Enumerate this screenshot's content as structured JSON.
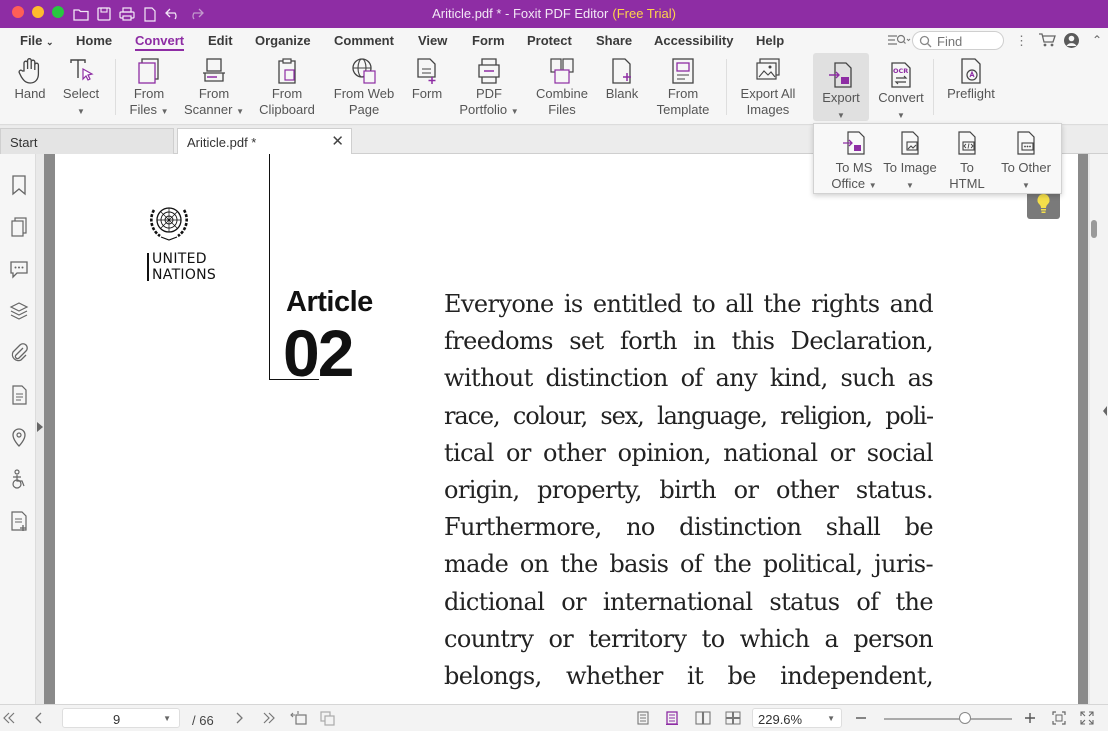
{
  "window": {
    "title": "Ariticle.pdf * - Foxit PDF Editor",
    "trial_label": "(Free Trial)"
  },
  "menu": {
    "items": [
      "File",
      "Home",
      "Convert",
      "Edit",
      "Organize",
      "Comment",
      "View",
      "Form",
      "Protect",
      "Share",
      "Accessibility",
      "Help"
    ],
    "active": "Convert",
    "find_placeholder": "Find"
  },
  "ribbon": {
    "hand": "Hand",
    "select": "Select",
    "from_files": [
      "From",
      "Files"
    ],
    "from_scanner": [
      "From",
      "Scanner"
    ],
    "from_clipboard": [
      "From",
      "Clipboard"
    ],
    "from_web_page": [
      "From Web",
      "Page"
    ],
    "form": "Form",
    "pdf_portfolio": [
      "PDF",
      "Portfolio"
    ],
    "combine_files": [
      "Combine",
      "Files"
    ],
    "blank": "Blank",
    "from_template": [
      "From",
      "Template"
    ],
    "export_all_images": [
      "Export All",
      "Images"
    ],
    "export": "Export",
    "convert": "Convert",
    "preflight": "Preflight"
  },
  "export_menu": {
    "to_ms_office": [
      "To MS",
      "Office"
    ],
    "to_image": "To Image",
    "to_html": [
      "To",
      "HTML"
    ],
    "to_other": "To Other"
  },
  "tabs": [
    {
      "label": "Start",
      "active": false
    },
    {
      "label": "Ariticle.pdf *",
      "active": true
    }
  ],
  "document": {
    "org_line1": "UNITED",
    "org_line2": "NATIONS",
    "article_label": "Article",
    "article_number": "02",
    "lines": [
      "Everyone is entitled to all the rights and",
      "freedoms set forth in this Declaration,",
      "without distinction of any kind, such as",
      "race, colour, sex, language, religion, poli-",
      "tical or other opinion, national or social",
      "origin, property, birth or other status.",
      "Furthermore, no distinction shall be",
      "made on the basis of the political, juris-",
      "dictional or international status of the",
      "country or territory to which a person",
      "belongs, whether it be independent,"
    ]
  },
  "status": {
    "current_page": "9",
    "total_pages": "/ 66",
    "zoom": "229.6%",
    "zoom_slider_fraction": 0.63
  },
  "colors": {
    "brand": "#8e2da4",
    "trial": "#ffd54a"
  }
}
